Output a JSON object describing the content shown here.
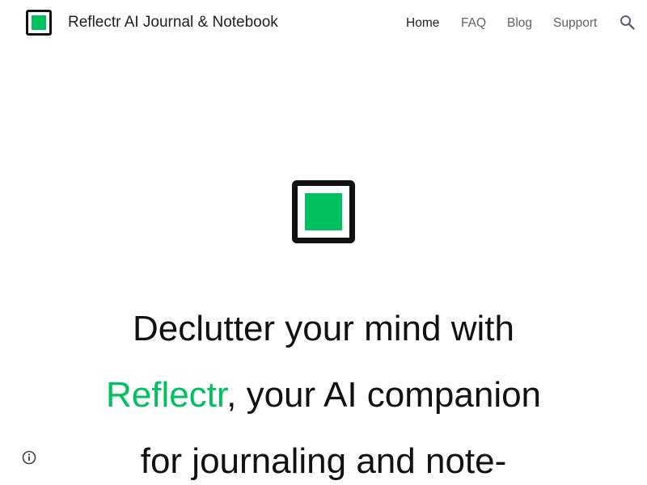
{
  "header": {
    "site_title": "Reflectr AI Journal & Notebook",
    "logo_icon": "reflectr-logo-icon",
    "nav": [
      {
        "label": "Home",
        "active": true
      },
      {
        "label": "FAQ",
        "active": false
      },
      {
        "label": "Blog",
        "active": false
      },
      {
        "label": "Support",
        "active": false
      }
    ],
    "search_icon": "search-icon"
  },
  "hero": {
    "logo_icon": "reflectr-logo-icon",
    "headline_part1": "Declutter your mind with",
    "headline_brand": "Reflectr",
    "headline_part2": ", your AI companion",
    "headline_part3": "for journaling and note-"
  },
  "footer": {
    "info_icon": "info-icon"
  },
  "colors": {
    "accent": "#00c060",
    "text": "#111111",
    "nav_text": "#5f6368"
  }
}
